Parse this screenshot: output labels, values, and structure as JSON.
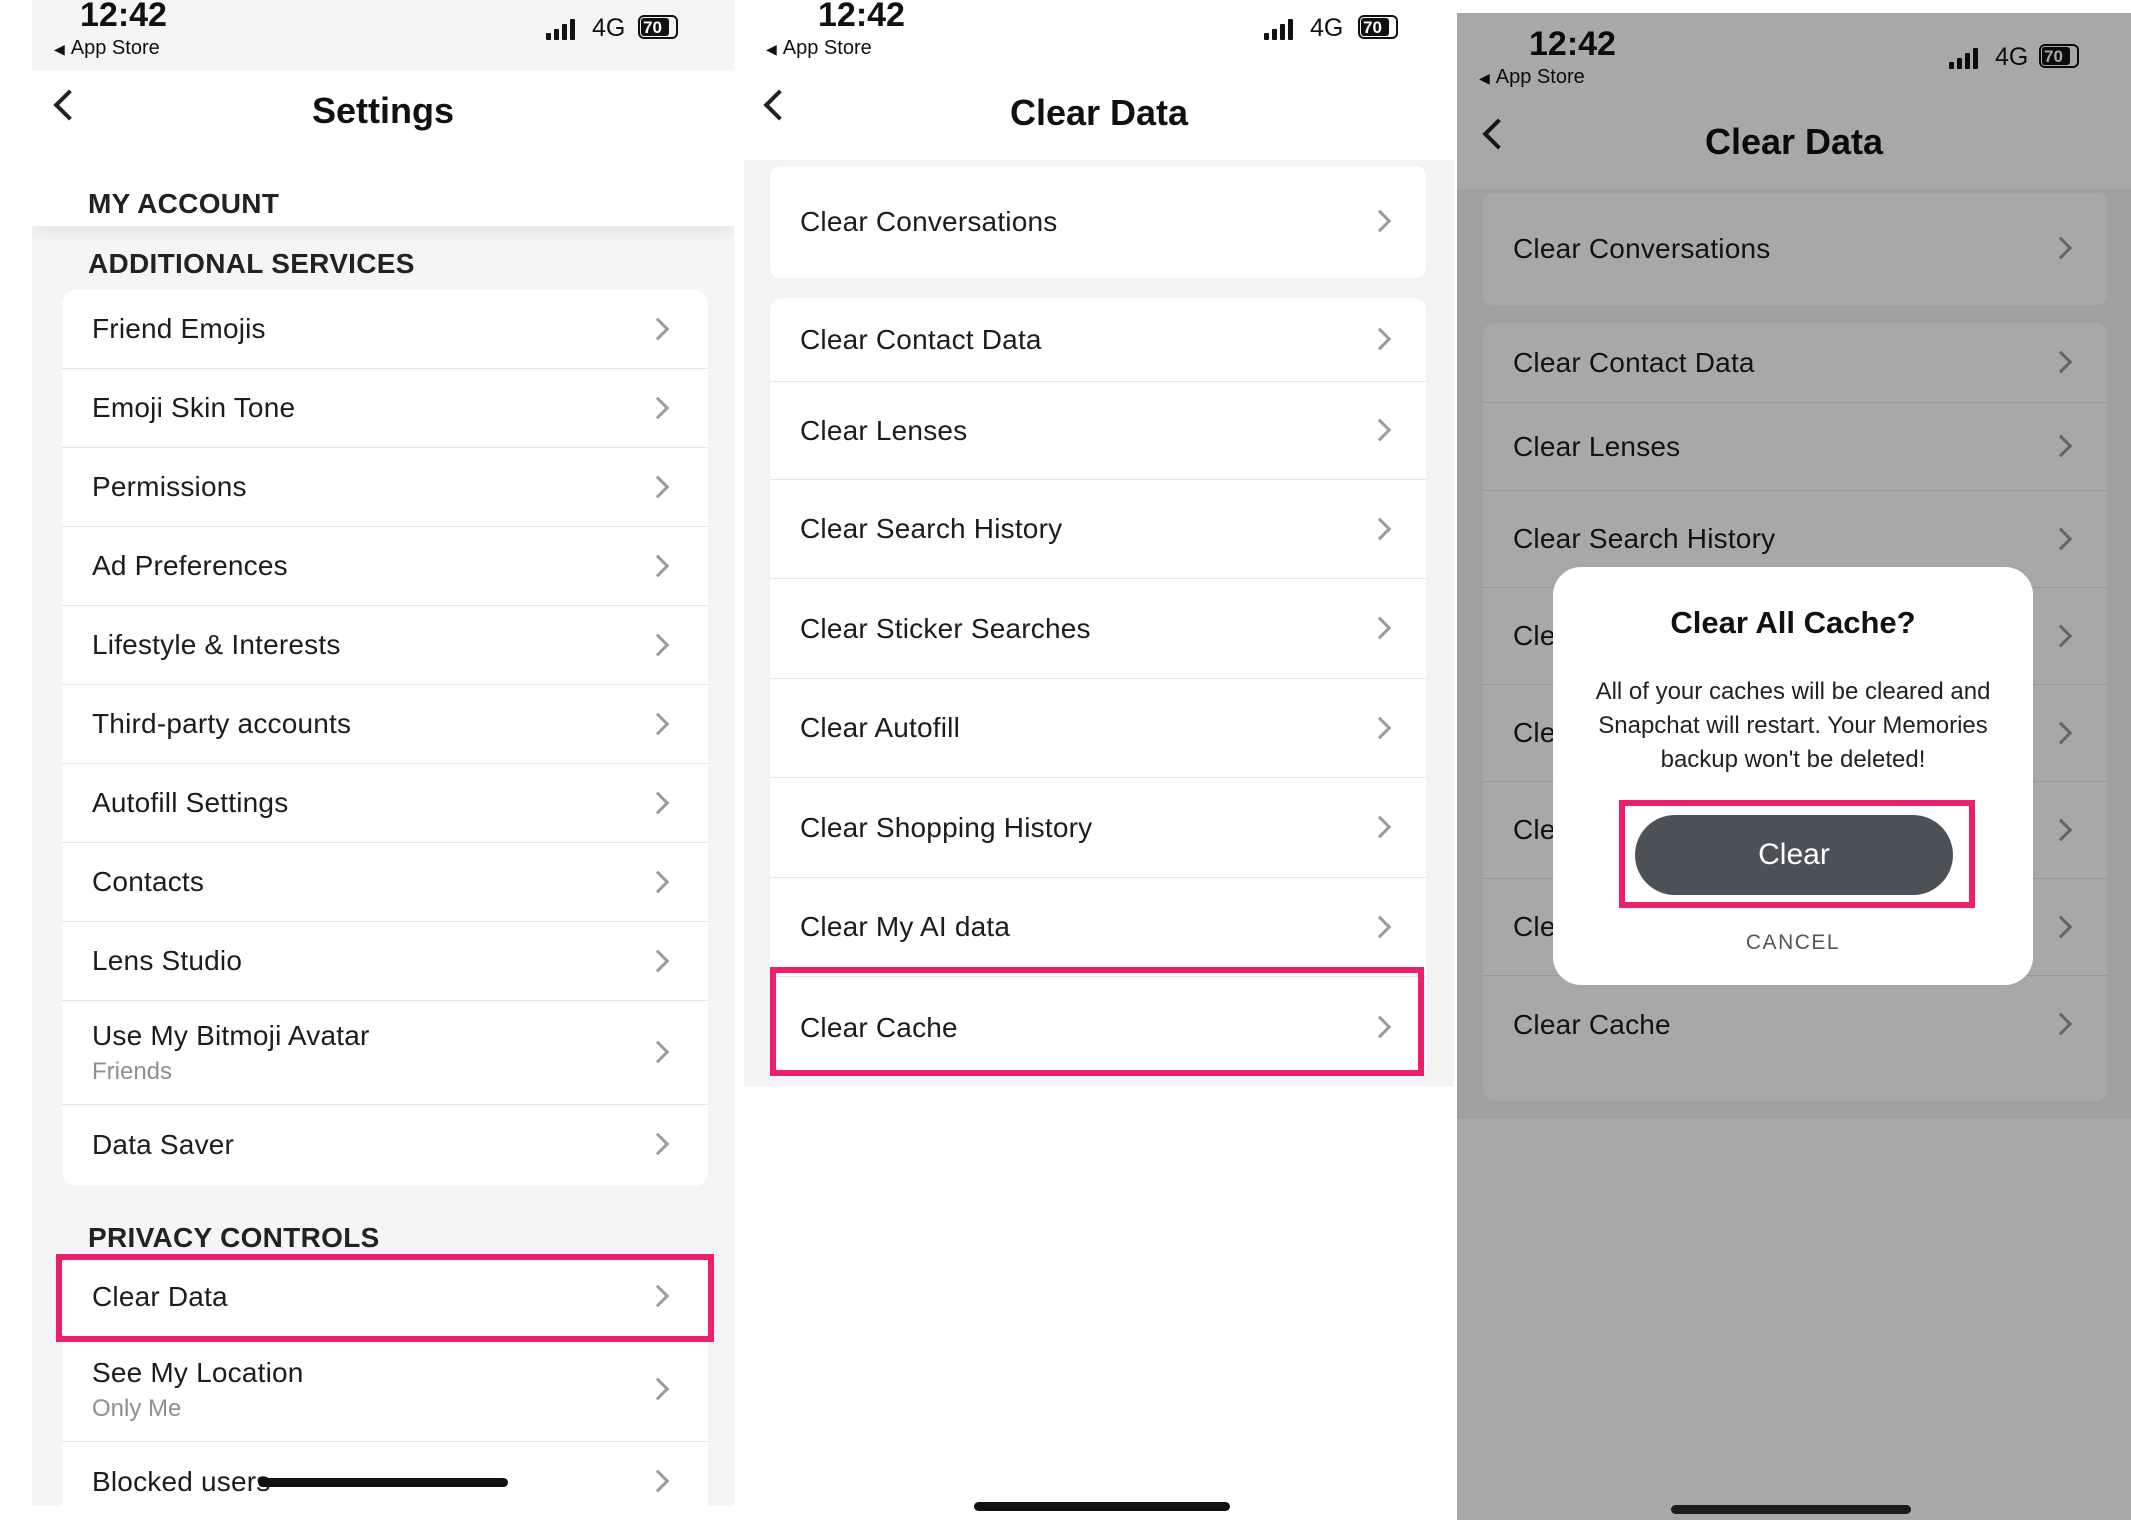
{
  "status": {
    "time": "12:42",
    "back_app": "App Store",
    "network": "4G",
    "battery": "70"
  },
  "screen1": {
    "title": "Settings",
    "section_my_account": "MY ACCOUNT",
    "section_additional": "ADDITIONAL SERVICES",
    "additional_items": [
      {
        "label": "Friend Emojis",
        "sub": ""
      },
      {
        "label": "Emoji Skin Tone",
        "sub": ""
      },
      {
        "label": "Permissions",
        "sub": ""
      },
      {
        "label": "Ad Preferences",
        "sub": ""
      },
      {
        "label": "Lifestyle & Interests",
        "sub": ""
      },
      {
        "label": "Third-party accounts",
        "sub": ""
      },
      {
        "label": "Autofill Settings",
        "sub": ""
      },
      {
        "label": "Contacts",
        "sub": ""
      },
      {
        "label": "Lens Studio",
        "sub": ""
      },
      {
        "label": "Use My Bitmoji Avatar",
        "sub": "Friends"
      },
      {
        "label": "Data Saver",
        "sub": ""
      }
    ],
    "section_privacy": "PRIVACY CONTROLS",
    "privacy_items": [
      {
        "label": "Clear Data",
        "sub": ""
      },
      {
        "label": "See My Location",
        "sub": "Only Me"
      },
      {
        "label": "Blocked users",
        "sub": ""
      }
    ]
  },
  "screen2": {
    "title": "Clear Data",
    "items": [
      {
        "label": "Clear Conversations"
      },
      {
        "label": "Clear Contact Data"
      },
      {
        "label": "Clear Lenses"
      },
      {
        "label": "Clear Search History"
      },
      {
        "label": "Clear Sticker Searches"
      },
      {
        "label": "Clear Autofill"
      },
      {
        "label": "Clear Shopping History"
      },
      {
        "label": "Clear My AI data"
      },
      {
        "label": "Clear Cache"
      }
    ]
  },
  "screen3": {
    "title": "Clear Data",
    "items": [
      {
        "label": "Clear Conversations"
      },
      {
        "label": "Clear Contact Data"
      },
      {
        "label": "Clear Lenses"
      },
      {
        "label": "Clear Search History"
      },
      {
        "label": "Cle"
      },
      {
        "label": "Cle"
      },
      {
        "label": "Cle"
      },
      {
        "label": "Cle"
      },
      {
        "label": "Clear Cache"
      }
    ],
    "dialog": {
      "title": "Clear All Cache?",
      "body": "All of your caches will be cleared and Snapchat will restart. Your Memories backup won't be deleted!",
      "confirm": "Clear",
      "cancel": "CANCEL"
    }
  },
  "colors": {
    "highlight": "#ee1f6a",
    "dialog_button": "#4a5157",
    "overlay": "rgba(0,0,0,0.34)"
  }
}
